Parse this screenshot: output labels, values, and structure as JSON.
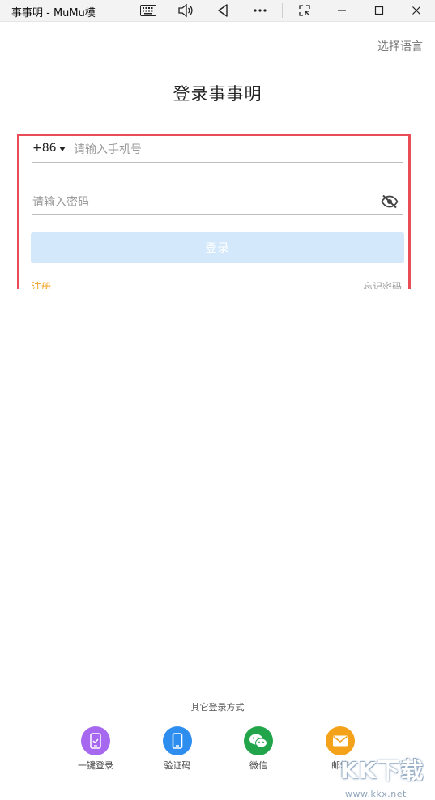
{
  "window": {
    "title": "事事明 - MuMu模拟器"
  },
  "header": {
    "language_link": "选择语言",
    "app_title": "登录事事明"
  },
  "login": {
    "country_code": "+86",
    "phone_placeholder": "请输入手机号",
    "password_placeholder": "请输入密码",
    "login_button": "登录",
    "register_link": "注册",
    "forgot_link": "忘记密码"
  },
  "other_login": {
    "label": "其它登录方式",
    "methods": [
      {
        "label": "一键登录",
        "icon": "phone-check-icon",
        "color": "#a768f0"
      },
      {
        "label": "验证码",
        "icon": "mobile-icon",
        "color": "#2d8ef0"
      },
      {
        "label": "微信",
        "icon": "wechat-icon",
        "color": "#22a54a"
      },
      {
        "label": "邮箱",
        "icon": "mail-icon",
        "color": "#f5a21b"
      }
    ]
  },
  "watermark": {
    "text": "KK下载",
    "url": "www.kkx.net"
  },
  "colors": {
    "accent_red": "#e84c55",
    "button_disabled": "#d4e8fb",
    "register_orange": "#f0a020"
  }
}
